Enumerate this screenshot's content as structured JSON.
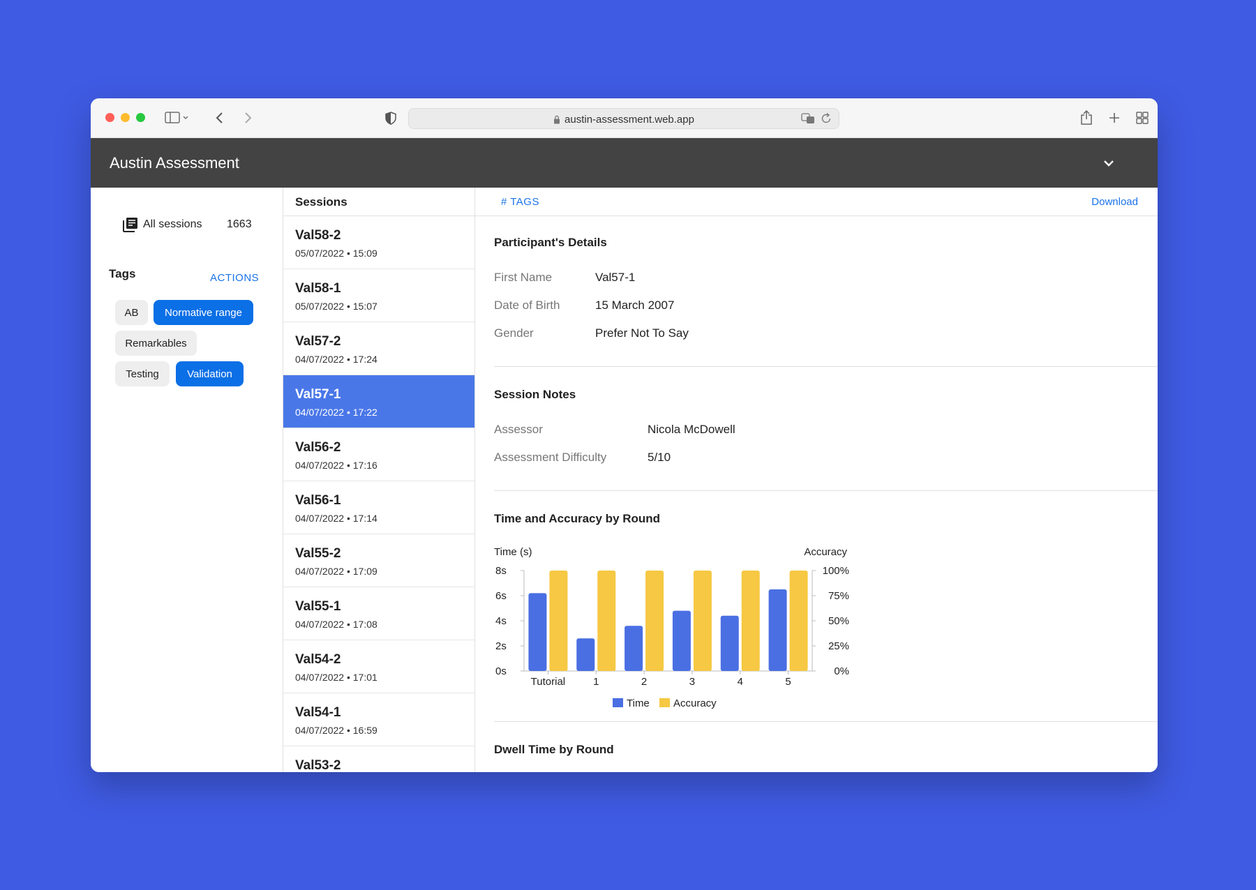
{
  "browser": {
    "url": "austin-assessment.web.app"
  },
  "app": {
    "title": "Austin Assessment"
  },
  "sidebar": {
    "all_sessions_label": "All sessions",
    "all_sessions_count": "1663",
    "tags_heading": "Tags",
    "actions_label": "ACTIONS",
    "tags": [
      {
        "label": "AB",
        "active": false
      },
      {
        "label": "Normative range",
        "active": true
      },
      {
        "label": "Remarkables",
        "active": false
      },
      {
        "label": "Testing",
        "active": false
      },
      {
        "label": "Validation",
        "active": true
      }
    ]
  },
  "sessions": {
    "heading": "Sessions",
    "items": [
      {
        "name": "Val58-2",
        "date": "05/07/2022 • 15:09"
      },
      {
        "name": "Val58-1",
        "date": "05/07/2022 • 15:07"
      },
      {
        "name": "Val57-2",
        "date": "04/07/2022 • 17:24"
      },
      {
        "name": "Val57-1",
        "date": "04/07/2022 • 17:22",
        "selected": true
      },
      {
        "name": "Val56-2",
        "date": "04/07/2022 • 17:16"
      },
      {
        "name": "Val56-1",
        "date": "04/07/2022 • 17:14"
      },
      {
        "name": "Val55-2",
        "date": "04/07/2022 • 17:09"
      },
      {
        "name": "Val55-1",
        "date": "04/07/2022 • 17:08"
      },
      {
        "name": "Val54-2",
        "date": "04/07/2022 • 17:01"
      },
      {
        "name": "Val54-1",
        "date": "04/07/2022 • 16:59"
      },
      {
        "name": "Val53-2",
        "date": ""
      }
    ]
  },
  "detail": {
    "tags_label": "# TAGS",
    "download_label": "Download",
    "participant": {
      "title": "Participant's Details",
      "fields": [
        {
          "label": "First Name",
          "value": "Val57-1"
        },
        {
          "label": "Date of Birth",
          "value": "15 March 2007"
        },
        {
          "label": "Gender",
          "value": "Prefer Not To Say"
        }
      ]
    },
    "notes": {
      "title": "Session Notes",
      "fields": [
        {
          "label": "Assessor",
          "value": "Nicola McDowell"
        },
        {
          "label": "Assessment Difficulty",
          "value": "5/10"
        }
      ]
    },
    "chart_title": "Time and Accuracy by Round",
    "dwell_title": "Dwell Time by Round"
  },
  "colors": {
    "time_bar": "#4a6fe3",
    "accuracy_bar": "#f6c843",
    "selected_row": "#4a77e8",
    "active_chip": "#0b6fe6",
    "link": "#1a73e8"
  },
  "chart_data": {
    "type": "bar",
    "categories": [
      "Tutorial",
      "1",
      "2",
      "3",
      "4",
      "5"
    ],
    "series": [
      {
        "name": "Time",
        "axis": "left",
        "values": [
          6.2,
          2.6,
          3.6,
          4.8,
          4.4,
          6.5
        ]
      },
      {
        "name": "Accuracy",
        "axis": "right",
        "values": [
          100,
          100,
          100,
          100,
          100,
          100
        ]
      }
    ],
    "y_left": {
      "label": "Time (s)",
      "ticks": [
        "0s",
        "2s",
        "4s",
        "6s",
        "8s"
      ],
      "range": [
        0,
        8
      ]
    },
    "y_right": {
      "label": "Accuracy",
      "ticks": [
        "0%",
        "25%",
        "50%",
        "75%",
        "100%"
      ],
      "range": [
        0,
        100
      ]
    },
    "legend": "bottom",
    "grid": false
  }
}
